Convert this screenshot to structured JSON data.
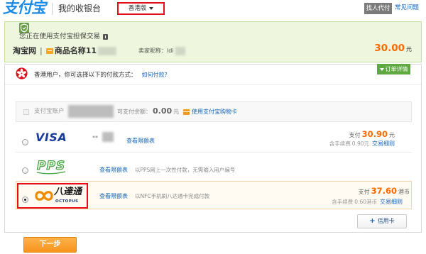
{
  "topbar": {
    "logo": "支付宝",
    "title": "我的收银台",
    "region": "香港版",
    "pay_for_me": "找人代付",
    "faq": "常见问题"
  },
  "notice": {
    "guarantee": "您正在使用支付宝担保交易",
    "merchant": "淘宝网",
    "divider": "|",
    "product": "商品名称11",
    "seller": "卖家昵称：ldi",
    "amount": "30.00",
    "currency": "元"
  },
  "payment": {
    "heading": "香港用户，你可选择以下的付款方式：",
    "help_link": "如何付款?",
    "order_details": "订单详情",
    "alipay_account": {
      "label": "支付宝账户",
      "balance_label": "可支付余额：",
      "balance": "0.00",
      "balance_unit": "元",
      "gift_card_link": "使用支付宝购物卡",
      "enabled": false
    },
    "methods": [
      {
        "logo": "VISA",
        "masked_number": "**",
        "limit_link": "查看限额表",
        "pay_label": "支付",
        "pay_amount": "30.90",
        "pay_unit": "元",
        "fee_label": "含手续费",
        "fee_amount": "0.90元",
        "rules_link": "交易细则",
        "selected": false
      },
      {
        "logo": "PPS",
        "limit_link": "查看限额表",
        "description": "以PPS网上一次性付款，无需输入用户编号",
        "selected": false
      },
      {
        "logo_cn": "八達通",
        "logo_en": "OCTOPUS",
        "limit_link": "查看限额表",
        "description": "以NFC手机刷八达通卡完成付款",
        "pay_label": "支付",
        "pay_amount": "37.60",
        "pay_unit": "港币",
        "fee_label": "含手续费",
        "fee_amount": "0.60港币",
        "rules_link": "交易细则",
        "selected": true
      }
    ],
    "add_card": {
      "plus": "+",
      "label": "信用卡"
    }
  },
  "actions": {
    "next": "下一步"
  },
  "colors": {
    "brand_blue": "#1e8ce4",
    "accent_orange": "#ff6a00",
    "link_blue": "#1767b9",
    "highlight_red": "#e60d17",
    "notice_green_bg": "#eef7dd",
    "tab_green": "#5ea940",
    "button_orange": "#f7941d"
  }
}
